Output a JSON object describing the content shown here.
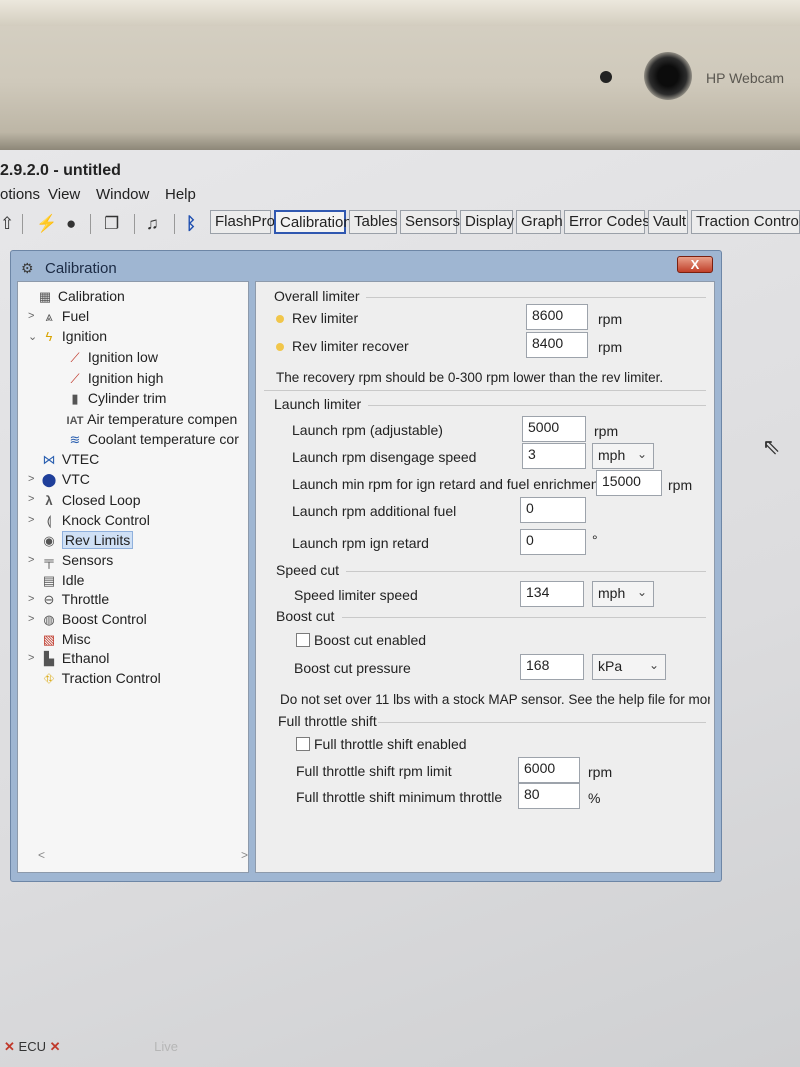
{
  "bezel": {
    "webcam_label": "HP Webcam"
  },
  "app": {
    "title": "2.9.2.0 - untitled"
  },
  "menu": [
    "otions",
    "View",
    "Window",
    "Help"
  ],
  "toolbar": {
    "icons": [
      "up-arrow-icon",
      "lightning-icon",
      "record-dot-icon",
      "window-copy-icon",
      "music-note-icon",
      "bluetooth-icon"
    ],
    "buttons": [
      "FlashPro",
      "Calibration",
      "Tables",
      "Sensors",
      "Display",
      "Graph",
      "Error Codes",
      "Vault",
      "Traction Control"
    ],
    "active": "Calibration"
  },
  "window": {
    "title": "Calibration",
    "close": "X"
  },
  "tree": [
    {
      "label": "Calibration",
      "icon": "calibration-icon"
    },
    {
      "label": "Fuel",
      "icon": "fuel-icon"
    },
    {
      "label": "Ignition",
      "icon": "ignition-icon"
    },
    {
      "label": "Ignition low",
      "icon": "map-icon"
    },
    {
      "label": "Ignition high",
      "icon": "map-icon"
    },
    {
      "label": "Cylinder trim",
      "icon": "cylinder-icon"
    },
    {
      "label": "Air temperature compen",
      "icon": "iat-icon"
    },
    {
      "label": "Coolant temperature cor",
      "icon": "coolant-icon"
    },
    {
      "label": "VTEC",
      "icon": "vtec-icon"
    },
    {
      "label": "VTC",
      "icon": "vtc-icon"
    },
    {
      "label": "Closed Loop",
      "icon": "lambda-icon"
    },
    {
      "label": "Knock Control",
      "icon": "knock-icon"
    },
    {
      "label": "Rev Limits",
      "icon": "rev-limits-icon"
    },
    {
      "label": "Sensors",
      "icon": "sensors-icon"
    },
    {
      "label": "Idle",
      "icon": "idle-icon"
    },
    {
      "label": "Throttle",
      "icon": "throttle-icon"
    },
    {
      "label": "Boost Control",
      "icon": "boost-icon"
    },
    {
      "label": "Misc",
      "icon": "misc-icon"
    },
    {
      "label": "Ethanol",
      "icon": "ethanol-icon"
    },
    {
      "label": "Traction Control",
      "icon": "traction-icon"
    }
  ],
  "tree_scroll": {
    "left": "<",
    "right": ">"
  },
  "rev": {
    "overall": "Overall limiter",
    "rev_limiter": {
      "label": "Rev limiter",
      "value": "8600",
      "unit": "rpm"
    },
    "rev_limiter_recover": {
      "label": "Rev limiter recover",
      "value": "8400",
      "unit": "rpm"
    },
    "note1": "The recovery rpm should be 0-300 rpm lower than the rev limiter.",
    "launch": "Launch limiter",
    "launch_rpm": {
      "label": "Launch rpm (adjustable)",
      "value": "5000",
      "unit": "rpm"
    },
    "launch_speed": {
      "label": "Launch rpm disengage speed",
      "value": "3",
      "unit": "mph"
    },
    "launch_min": {
      "label": "Launch min rpm for ign retard and fuel enrichment",
      "value": "15000",
      "unit": "rpm"
    },
    "launch_fuel": {
      "label": "Launch rpm additional fuel",
      "value": "0"
    },
    "launch_ign": {
      "label": "Launch rpm ign retard",
      "value": "0",
      "unit": "°"
    },
    "speed_cut": "Speed cut",
    "speed_limiter": {
      "label": "Speed limiter speed",
      "value": "134",
      "unit": "mph"
    },
    "boost_cut": "Boost cut",
    "boost_enabled": {
      "label": "Boost cut enabled",
      "checked": false
    },
    "boost_pressure": {
      "label": "Boost cut pressure",
      "value": "168",
      "unit": "kPa"
    },
    "note2": "Do not set over 11 lbs with a stock MAP sensor.  See the help file for mor",
    "fts": "Full throttle shift",
    "fts_enabled": {
      "label": "Full throttle shift enabled",
      "checked": false
    },
    "fts_rpm": {
      "label": "Full throttle shift rpm limit",
      "value": "6000",
      "unit": "rpm"
    },
    "fts_throttle": {
      "label": "Full throttle shift minimum throttle",
      "value": "80",
      "unit": "%"
    }
  },
  "status": {
    "ecu": "ECU",
    "live": "Live"
  }
}
